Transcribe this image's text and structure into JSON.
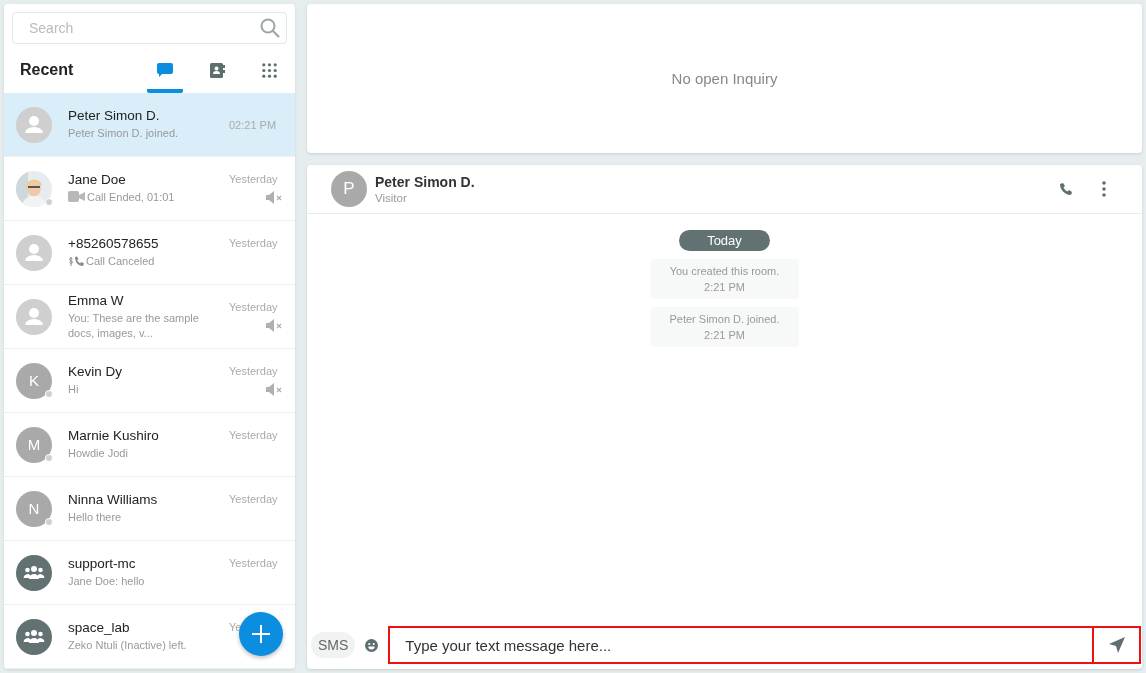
{
  "search": {
    "placeholder": "Search"
  },
  "list_title": "Recent",
  "tabs": [
    {
      "kind": "chat",
      "selected": true
    },
    {
      "kind": "contacts",
      "selected": false
    },
    {
      "kind": "dialpad",
      "selected": false
    }
  ],
  "conversations": [
    {
      "name": "Peter Simon D.",
      "preview": "Peter Simon D. joined.",
      "time": "02:21 PM",
      "kind": "person",
      "selected": true,
      "status_dot": false,
      "muted": false
    },
    {
      "name": "Jane Doe",
      "preview": "Call Ended, 01:01",
      "preview_icon": {
        "kind": "video"
      },
      "time": "Yesterday",
      "kind": "picture",
      "selected": false,
      "status_dot": true,
      "muted": true
    },
    {
      "name": "+85260578655",
      "preview": "Call Canceled",
      "preview_icon": {
        "kind": "paid-call"
      },
      "time": "Yesterday",
      "kind": "person",
      "selected": false,
      "status_dot": false,
      "muted": false
    },
    {
      "name": "Emma W",
      "preview": "You: These are the sample docs, images, v...",
      "time": "Yesterday",
      "kind": "person",
      "selected": false,
      "status_dot": false,
      "muted": true
    },
    {
      "name": "Kevin Dy",
      "preview": "Hi",
      "time": "Yesterday",
      "kind": "letter",
      "initial": "K",
      "selected": false,
      "status_dot": true,
      "muted": true
    },
    {
      "name": "Marnie Kushiro",
      "preview": "Howdie Jodi",
      "time": "Yesterday",
      "kind": "letter",
      "initial": "M",
      "selected": false,
      "status_dot": true,
      "muted": false
    },
    {
      "name": "Ninna Williams",
      "preview": "Hello there",
      "time": "Yesterday",
      "kind": "letter",
      "initial": "N",
      "selected": false,
      "status_dot": true,
      "muted": false
    },
    {
      "name": "support-mc",
      "preview": "Jane Doe: hello",
      "time": "Yesterday",
      "kind": "group",
      "selected": false,
      "status_dot": false,
      "muted": false
    },
    {
      "name": "space_lab",
      "preview": "Zeko Ntuli (Inactive) left.",
      "time": "Ye",
      "kind": "group",
      "selected": false,
      "status_dot": false,
      "muted": false
    }
  ],
  "inquiry": {
    "text": "No open Inquiry"
  },
  "chat": {
    "initial": "P",
    "name": "Peter Simon D.",
    "role": "Visitor",
    "date_pill": "Today",
    "messages": [
      {
        "text": "You created this room.",
        "time": "2:21 PM"
      },
      {
        "text": "Peter Simon D. joined.",
        "time": "2:21 PM"
      }
    ],
    "sms": "SMS",
    "message_value": "Type your text message here..."
  }
}
